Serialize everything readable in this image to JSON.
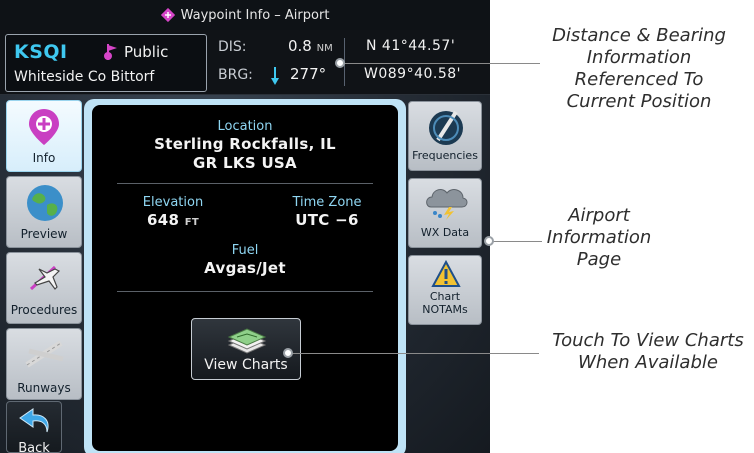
{
  "topbar": {
    "title": "Waypoint Info – Airport"
  },
  "header": {
    "ident": "KSQI",
    "visibility": "Public",
    "airport_name": "Whiteside Co Bittorf",
    "dis_label": "DIS:",
    "dis_value": "0.8",
    "dis_unit": "NM",
    "brg_label": "BRG:",
    "brg_value": "277°",
    "lat": "N 41°44.57'",
    "lon": "W089°40.58'"
  },
  "left_tabs": [
    {
      "label": "Info",
      "icon": "info-pin-icon"
    },
    {
      "label": "Preview",
      "icon": "globe-icon"
    },
    {
      "label": "Procedures",
      "icon": "plane-procedures-icon"
    },
    {
      "label": "Runways",
      "icon": "runways-icon"
    }
  ],
  "right_tabs": [
    {
      "label": "Frequencies",
      "icon": "frequency-dial-icon"
    },
    {
      "label": "WX Data",
      "icon": "weather-cloud-icon"
    },
    {
      "label_line1": "Chart",
      "label_line2": "NOTAMs",
      "icon": "warning-triangle-icon"
    }
  ],
  "info": {
    "location_title": "Location",
    "location_line1": "Sterling Rockfalls, IL",
    "location_line2": "GR LKS USA",
    "elevation_title": "Elevation",
    "elevation_value": "648",
    "elevation_unit": "FT",
    "timezone_title": "Time Zone",
    "timezone_value": "UTC −6",
    "fuel_title": "Fuel",
    "fuel_value": "Avgas/Jet"
  },
  "view_charts": {
    "label": "View Charts",
    "icon": "charts-stack-icon"
  },
  "back": {
    "label": "Back",
    "icon": "back-arrow-icon"
  },
  "callouts": {
    "distance": [
      "Distance & Bearing",
      "Information",
      "Referenced To",
      "Current Position"
    ],
    "airport": [
      "Airport",
      "Information",
      "Page"
    ],
    "charts": [
      "Touch To View Charts",
      "When Available"
    ]
  },
  "colors": {
    "ident": "#3fc8f0",
    "accent": "#bfe3f6",
    "title_text": "#8fd6f2"
  }
}
